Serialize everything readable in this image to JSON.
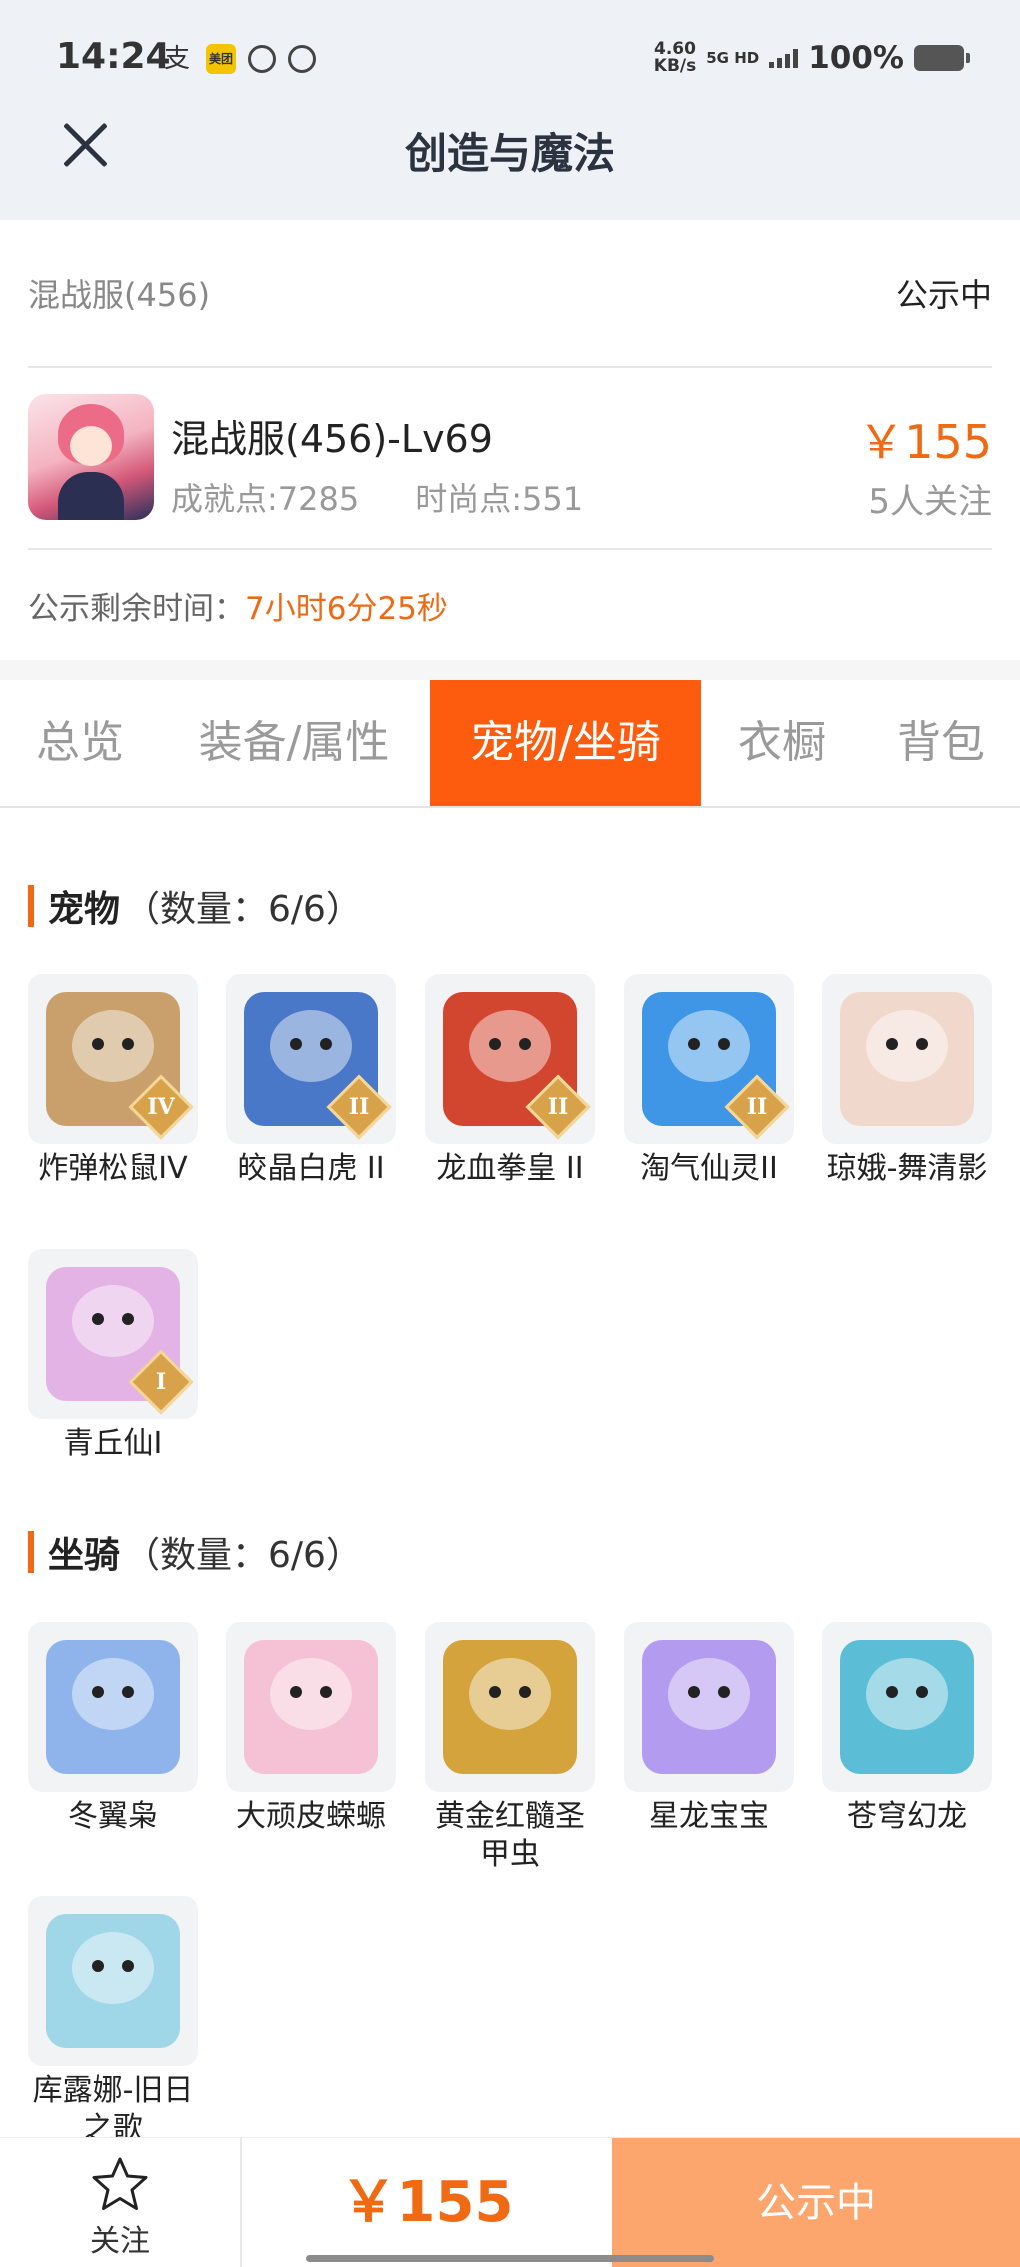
{
  "status_bar": {
    "time": "14:24",
    "icons": [
      "alipay-icon",
      "meituan-icon",
      "qq-icon",
      "browser-icon"
    ],
    "meituan_label": "美团",
    "net_speed_value": "4.60",
    "net_speed_unit": "KB/s",
    "network": "5G HD",
    "battery": "100%"
  },
  "header": {
    "title": "创造与魔法",
    "close_icon": "close-icon"
  },
  "listing": {
    "server": "混战服(456)",
    "status": "公示中",
    "character_name": "混战服(456)-Lv69",
    "achievement": "成就点:7285",
    "fashion": "时尚点:551",
    "price": "￥155",
    "followers": "5人关注",
    "countdown_label": "公示剩余时间：",
    "countdown_value": "7小时6分25秒"
  },
  "tabs": [
    {
      "label": "总览",
      "active": false
    },
    {
      "label": "装备/属性",
      "active": false
    },
    {
      "label": "宠物/坐骑",
      "active": true
    },
    {
      "label": "衣橱",
      "active": false
    },
    {
      "label": "背包",
      "active": false
    }
  ],
  "pets": {
    "title": "宠物",
    "count": "（数量：6/6）",
    "items": [
      {
        "name": "炸弹松鼠IV",
        "tier": "IV",
        "color": "#c9a06c"
      },
      {
        "name": "皎晶白虎 II",
        "tier": "II",
        "color": "#4a78c8"
      },
      {
        "name": "龙血拳皇 II",
        "tier": "II",
        "color": "#d2452e"
      },
      {
        "name": "淘气仙灵II",
        "tier": "II",
        "color": "#3f95e6"
      },
      {
        "name": "琼娥-舞清影",
        "tier": "",
        "color": "#f1d8cc"
      },
      {
        "name": "青丘仙I",
        "tier": "I",
        "color": "#e4b3e6"
      }
    ]
  },
  "mounts": {
    "title": "坐骑",
    "count": "（数量：6/6）",
    "items": [
      {
        "name": "冬翼枭",
        "color": "#8fb4ec"
      },
      {
        "name": "大顽皮蝾螈",
        "color": "#f4c2d4"
      },
      {
        "name": "黄金红髓圣甲虫",
        "color": "#d4a33c"
      },
      {
        "name": "星龙宝宝",
        "color": "#b39cf0"
      },
      {
        "name": "苍穹幻龙",
        "color": "#5bbdd6"
      },
      {
        "name": "库露娜-旧日之歌",
        "color": "#9fd6e8"
      }
    ]
  },
  "bottom_bar": {
    "follow_label": "关注",
    "price": "￥155",
    "status_button": "公示中"
  },
  "colors": {
    "accent": "#fd5b0e",
    "price": "#f06a13",
    "button_disabled": "#fca66e"
  }
}
